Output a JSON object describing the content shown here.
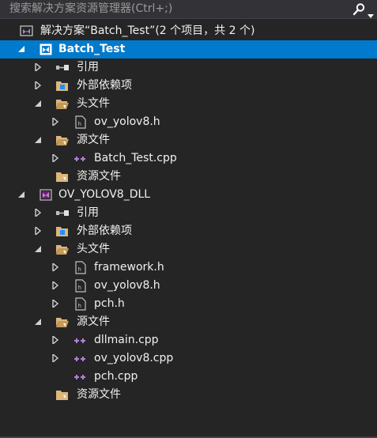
{
  "search": {
    "placeholder": "搜索解决方案资源管理器(Ctrl+;)"
  },
  "tree": {
    "solution": "解决方案“Batch_Test”(2 个项目，共 2 个)",
    "project1": {
      "name": "Batch_Test",
      "references": "引用",
      "external_deps": "外部依赖项",
      "header_files": "头文件",
      "header_items": [
        "ov_yolov8.h"
      ],
      "source_files": "源文件",
      "source_items": [
        "Batch_Test.cpp"
      ],
      "resource_files": "资源文件"
    },
    "project2": {
      "name": "OV_YOLOV8_DLL",
      "references": "引用",
      "external_deps": "外部依赖项",
      "header_files": "头文件",
      "header_items": [
        "framework.h",
        "ov_yolov8.h",
        "pch.h"
      ],
      "source_files": "源文件",
      "source_items": [
        "dllmain.cpp",
        "ov_yolov8.cpp",
        "pch.cpp"
      ],
      "resource_files": "资源文件"
    }
  },
  "colors": {
    "background": "#252526",
    "selection": "#007acc",
    "text": "#f1f1f1",
    "search_text": "#999999",
    "folder": "#dcb67a",
    "cpp_accent": "#b180d7",
    "project_accent": "#68217a"
  }
}
